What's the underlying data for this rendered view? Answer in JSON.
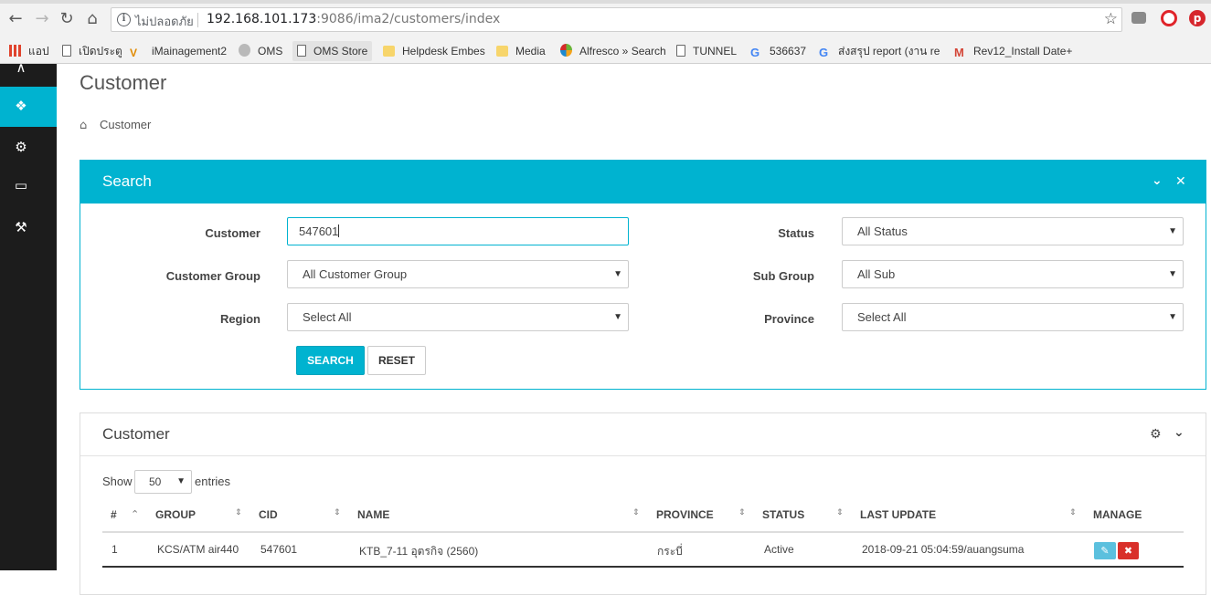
{
  "browser": {
    "secure_label": "ไม่ปลอดภัย",
    "url_host": "192.168.101.173",
    "url_path": ":9086/ima2/customers/index",
    "bookmarks": [
      {
        "label": "แอป"
      },
      {
        "label": "เปิดประตู"
      },
      {
        "label": "iMainagement2"
      },
      {
        "label": "OMS"
      },
      {
        "label": "OMS Store"
      },
      {
        "label": "Helpdesk Embes"
      },
      {
        "label": "Media"
      },
      {
        "label": "Alfresco » Search"
      },
      {
        "label": "TUNNEL"
      },
      {
        "label": "536637"
      },
      {
        "label": "ส่งสรุป report (งาน rep"
      },
      {
        "label": "Rev12_Install Date+"
      }
    ]
  },
  "page": {
    "title": "Customer",
    "breadcrumb": "Customer"
  },
  "search": {
    "title": "Search",
    "labels": {
      "customer": "Customer",
      "customer_group": "Customer Group",
      "region": "Region",
      "status": "Status",
      "sub_group": "Sub Group",
      "province": "Province"
    },
    "values": {
      "customer": "547601",
      "customer_group": "All Customer Group",
      "region": "Select All",
      "status": "All Status",
      "sub_group": "All Sub",
      "province": "Select All"
    },
    "search_button": "SEARCH",
    "reset_button": "RESET"
  },
  "customers": {
    "title": "Customer",
    "show_label": "Show",
    "entries_value": "50",
    "entries_label": "entries",
    "columns": [
      "#",
      "GROUP",
      "CID",
      "NAME",
      "PROVINCE",
      "STATUS",
      "LAST UPDATE",
      "MANAGE"
    ],
    "rows": [
      {
        "no": "1",
        "group": "KCS/ATM air440",
        "cid": "547601",
        "name": "KTB_7-11 อุตรกิจ (2560)",
        "province": "กระบี่",
        "status": "Active",
        "last_update": "2018-09-21 05:04:59/auangsuma"
      }
    ]
  },
  "colors": {
    "accent": "#00b3d0",
    "sidebar": "#1c1c1c",
    "danger": "#d9302a",
    "edit": "#5bc0de"
  }
}
